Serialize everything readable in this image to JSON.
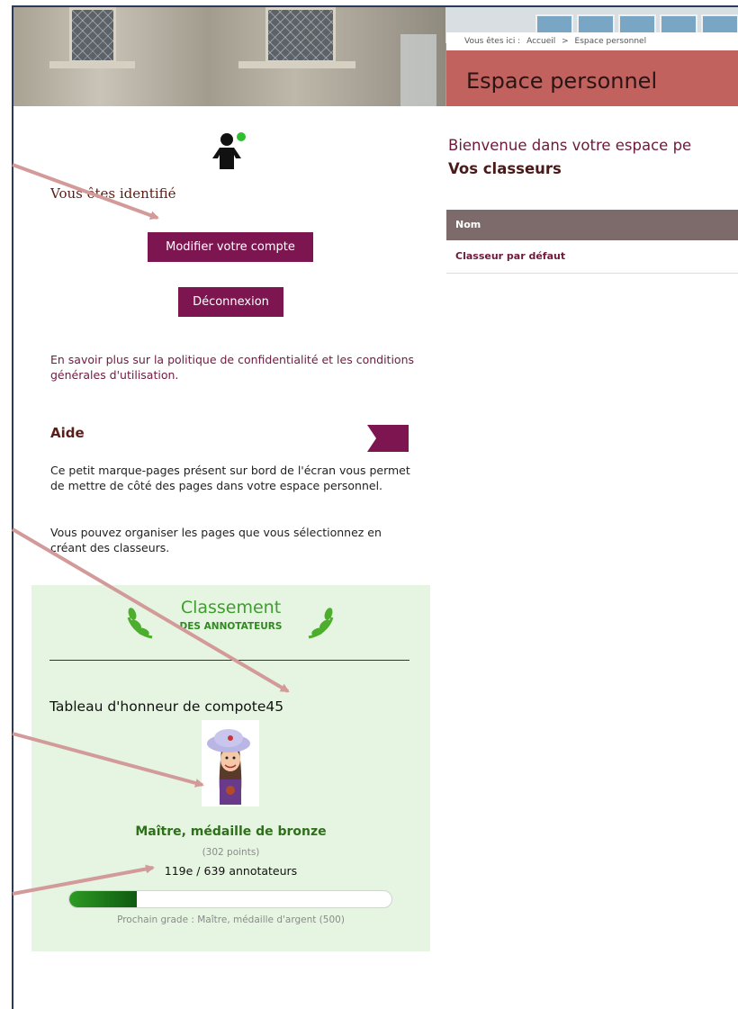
{
  "breadcrumb": {
    "prefix": "Vous êtes ici :",
    "home": "Accueil",
    "separator": ">",
    "current": "Espace personnel"
  },
  "page_title": "Espace personnel",
  "account": {
    "status": "Vous êtes identifié",
    "modify_label": "Modifier votre compte",
    "logout_label": "Déconnexion",
    "policy_text": "En savoir plus sur la politique de confidentialité et les conditions générales d'utilisation."
  },
  "help": {
    "title": "Aide",
    "paragraph1": "Ce petit marque-pages présent sur bord de l'écran vous permet de mettre de côté des pages dans votre espace personnel.",
    "paragraph2": "Vous pouvez organiser les pages que vous sélectionnez en créant des classeurs."
  },
  "ranking": {
    "title": "Classement",
    "subtitle": "DES ANNOTATEURS",
    "honor_title": "Tableau d'honneur de compote45",
    "grade": "Maître, médaille de bronze",
    "points": "(302 points)",
    "position": "119e / 639 annotateurs",
    "progress_fraction": 0.21,
    "next_grade": "Prochain grade : Maître, médaille d'argent (500)"
  },
  "main": {
    "welcome": "Bienvenue dans votre espace pe",
    "binders_title": "Vos classeurs",
    "table_header": "Nom",
    "rows": [
      "Classeur par défaut"
    ]
  },
  "colors": {
    "accent": "#7d1650",
    "title_bar": "#c2625f",
    "ranking_bg": "#e6f5e1",
    "arrow": "#d39a9a"
  }
}
